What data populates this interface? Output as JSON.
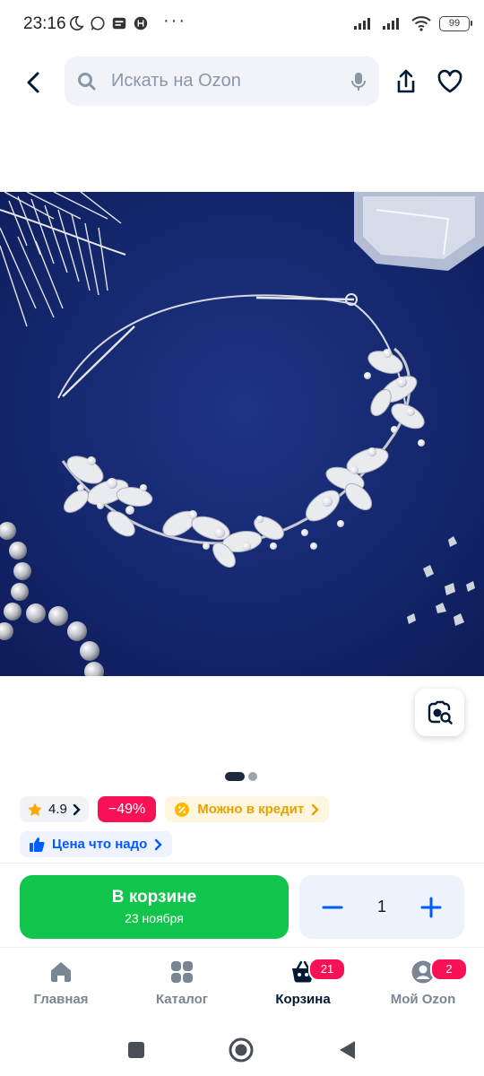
{
  "status_bar": {
    "time": "23:16",
    "battery": "99",
    "more": "···"
  },
  "header": {
    "search_placeholder": "Искать на Ozon"
  },
  "gallery": {
    "current_index": 1,
    "total_images": 2
  },
  "badges": {
    "rating": "4.9",
    "discount": "−49%",
    "credit": "Можно в кредит",
    "price_label": "Цена что надо"
  },
  "purchase": {
    "cart_label": "В корзине",
    "delivery_date": "23 ноября",
    "quantity": "1"
  },
  "bottom_nav": {
    "items": [
      {
        "label": "Главная",
        "icon": "home-icon"
      },
      {
        "label": "Каталог",
        "icon": "grid-icon"
      },
      {
        "label": "Корзина",
        "icon": "basket-icon",
        "badge": "21",
        "active": true
      },
      {
        "label": "Мой Ozon",
        "icon": "profile-icon",
        "badge": "2"
      }
    ]
  },
  "colors": {
    "accent_blue": "#005bff",
    "cart_green": "#10c44c",
    "discount_pink": "#f91155",
    "credit_yellow": "#e6a300"
  }
}
